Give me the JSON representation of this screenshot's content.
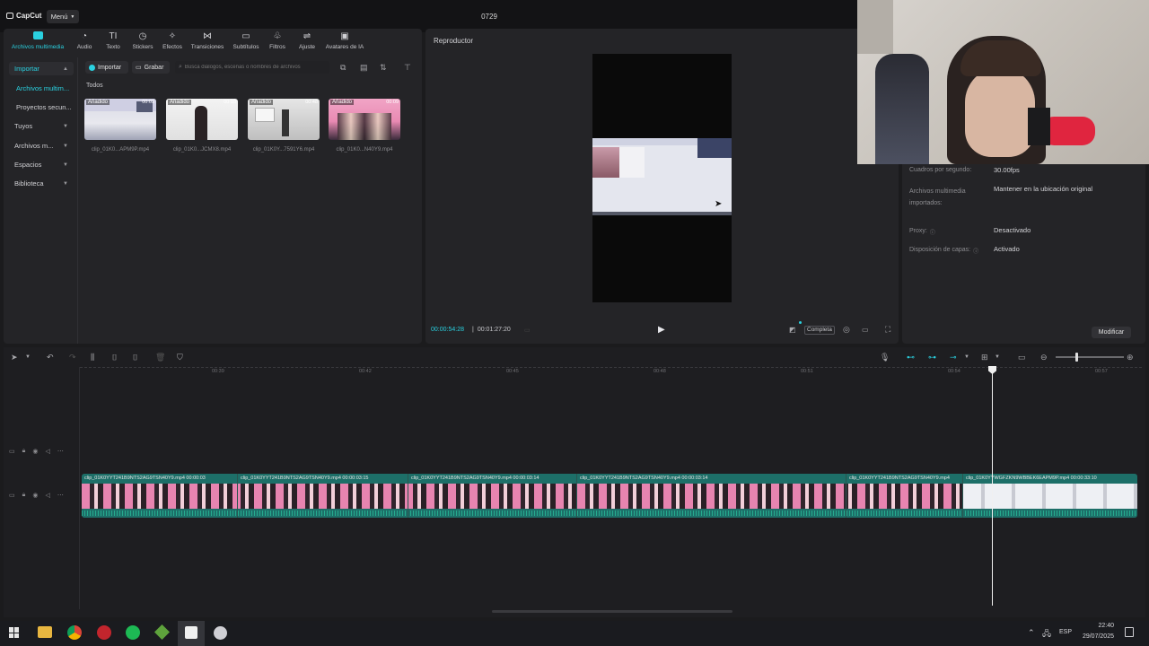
{
  "app": {
    "logo_text": "CapCut",
    "menu_label": "Menú",
    "project_title": "0729"
  },
  "toolbar": [
    {
      "label": "Archivos multimedia",
      "icon": "media-icon"
    },
    {
      "label": "Audio",
      "icon": "audio-icon"
    },
    {
      "label": "Texto",
      "icon": "text-icon"
    },
    {
      "label": "Stickers",
      "icon": "sticker-icon"
    },
    {
      "label": "Efectos",
      "icon": "effects-icon"
    },
    {
      "label": "Transiciones",
      "icon": "transitions-icon"
    },
    {
      "label": "Subtítulos",
      "icon": "subtitles-icon"
    },
    {
      "label": "Filtros",
      "icon": "filters-icon"
    },
    {
      "label": "Ajuste",
      "icon": "adjust-icon"
    },
    {
      "label": "Avatares de IA",
      "icon": "ai-avatar-icon"
    }
  ],
  "sidebar": {
    "items": [
      {
        "label": "Importar"
      },
      {
        "label": "Archivos multim..."
      },
      {
        "label": "Proyectos secun..."
      },
      {
        "label": "Tuyos"
      },
      {
        "label": "Archivos m..."
      },
      {
        "label": "Espacios"
      },
      {
        "label": "Biblioteca"
      }
    ]
  },
  "media": {
    "import_label": "Importar",
    "record_label": "Grabar",
    "search_placeholder": "Busca diálogos, escenas o nombres de archivos",
    "filter_all": "Todos",
    "clips": [
      {
        "tag": "Añadido",
        "duration": "00:03",
        "name": "clip_01K0...APM9P.mp4"
      },
      {
        "tag": "Añadido",
        "duration": "00:10",
        "name": "clip_01K0...JCMX8.mp4"
      },
      {
        "tag": "Añadido",
        "duration": "00:48",
        "name": "clip_01K0Y...7591Y6.mp4"
      },
      {
        "tag": "Añadido",
        "duration": "00:09",
        "name": "clip_01K0...N40Y9.mp4"
      }
    ]
  },
  "player": {
    "title": "Reproductor",
    "current_time": "00:00:54:28",
    "total_time": "00:01:27:20",
    "ratio_label": "Completa"
  },
  "properties": {
    "rows": [
      {
        "label": "Cuadros por segundo:",
        "value": "30.00fps"
      },
      {
        "label": "Archivos multimedia importados:",
        "value": "Mantener en la ubicación original"
      },
      {
        "label": "Proxy:",
        "value": "Desactivado"
      },
      {
        "label": "Disposición de capas:",
        "value": "Activado"
      }
    ],
    "modify_label": "Modificar"
  },
  "timeline": {
    "ruler": [
      "00:39",
      "00:42",
      "00:45",
      "00:48",
      "00:51",
      "00:54",
      "00:57"
    ],
    "clips": [
      {
        "label": "clip_01K0YYT241B9NTS2AG9TSN40Y9.mp4   00:00:03"
      },
      {
        "label": "clip_01K0YYT241B9NTS2AG9TSN40Y9.mp4   00:00:03:15"
      },
      {
        "label": "clip_01K0YYT241B9NTS2AG9TSN40Y9.mp4   00:00:03:14"
      },
      {
        "label": "clip_01K0YYT241B9NTS2AG9TSN40Y9.mp4   00:00:03:14"
      },
      {
        "label": "clip_01K0YYT241B9NTS2AG9TSN40Y9.mp4"
      },
      {
        "label": "clip_01K0YYWGFZKN9WBBEK6EAPM9P.mp4   00:00:33:10"
      }
    ]
  },
  "taskbar": {
    "lang": "ESP",
    "time": "22:40",
    "date": "29/07/2025"
  },
  "colors": {
    "accent": "#2ad1e0",
    "clip_pink": "#e27ba6",
    "track_teal": "#1d6f68"
  }
}
